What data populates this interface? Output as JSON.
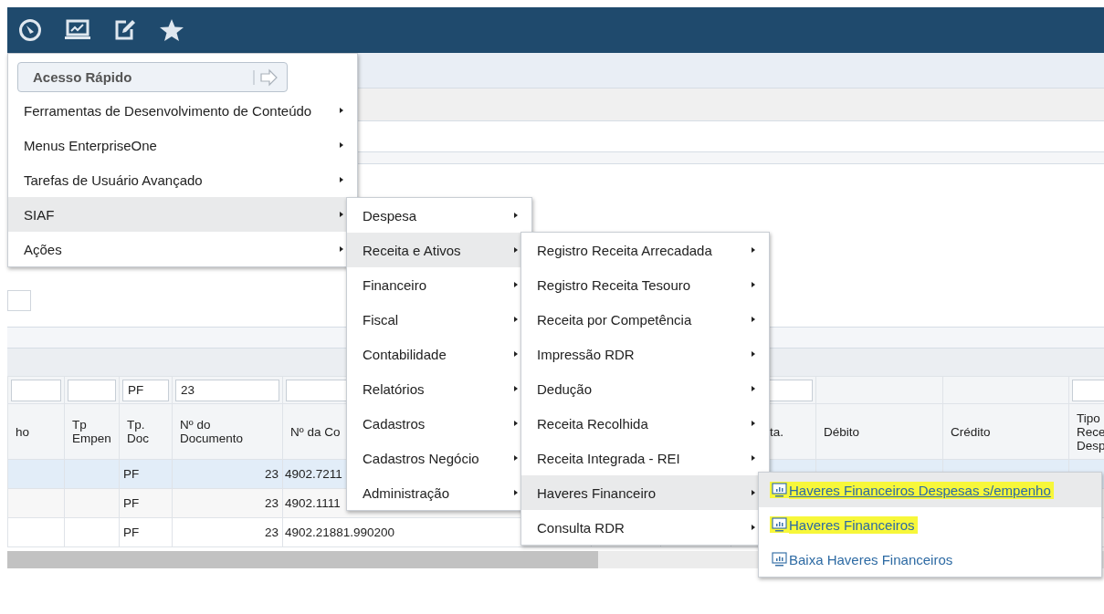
{
  "quick_access": {
    "placeholder": "Acesso Rápido"
  },
  "menu": {
    "items": [
      {
        "label": "Ferramentas de Desenvolvimento de Conteúdo",
        "selected": false
      },
      {
        "label": "Menus EnterpriseOne",
        "selected": false
      },
      {
        "label": "Tarefas de Usuário Avançado",
        "selected": false
      },
      {
        "label": "SIAF",
        "selected": true
      },
      {
        "label": "Ações",
        "selected": false
      }
    ]
  },
  "submenu_1": {
    "items": [
      {
        "label": "Despesa",
        "selected": false
      },
      {
        "label": "Receita e Ativos",
        "selected": true
      },
      {
        "label": "Financeiro",
        "selected": false
      },
      {
        "label": "Fiscal",
        "selected": false
      },
      {
        "label": "Contabilidade",
        "selected": false
      },
      {
        "label": "Relatórios",
        "selected": false
      },
      {
        "label": "Cadastros",
        "selected": false
      },
      {
        "label": "Cadastros Negócio",
        "selected": false
      },
      {
        "label": "Administração",
        "selected": false
      }
    ]
  },
  "submenu_2": {
    "items": [
      {
        "label": "Registro Receita Arrecadada",
        "selected": false
      },
      {
        "label": "Registro Receita Tesouro",
        "selected": false
      },
      {
        "label": "Receita por Competência",
        "selected": false
      },
      {
        "label": "Impressão RDR",
        "selected": false
      },
      {
        "label": "Dedução",
        "selected": false
      },
      {
        "label": "Receita Recolhida",
        "selected": false
      },
      {
        "label": "Receita Integrada - REI",
        "selected": false
      },
      {
        "label": "Haveres Financeiro",
        "selected": true
      },
      {
        "label": "Consulta RDR",
        "selected": false
      }
    ]
  },
  "submenu_3": {
    "items": [
      {
        "label": "Haveres Financeiros Despesas s/empenho",
        "selected": true,
        "highlighted": true
      },
      {
        "label": "Haveres Financeiros",
        "selected": false,
        "highlighted": true
      },
      {
        "label": "Baixa Haveres Financeiros",
        "selected": false,
        "highlighted": false
      }
    ]
  },
  "table": {
    "filters": [
      {
        "kind": "input"
      },
      {
        "kind": "input"
      },
      {
        "kind": "input",
        "value": "PF"
      },
      {
        "kind": "input",
        "value": "23"
      },
      {
        "kind": "input"
      },
      {
        "kind": "input"
      },
      {
        "kind": "none"
      },
      {
        "kind": "none"
      },
      {
        "kind": "input"
      }
    ],
    "columns": [
      {
        "label": "ho"
      },
      {
        "label": "Tp\nEmpen"
      },
      {
        "label": "Tp.\nDoc"
      },
      {
        "label": "Nº do\nDocumento"
      },
      {
        "label": "Nº da Co"
      },
      {
        "label": "ta."
      },
      {
        "label": "Débito"
      },
      {
        "label": "Crédito"
      },
      {
        "label": "Tipo\nRece\nDesp"
      }
    ],
    "rows": [
      {
        "selected": true,
        "cells": [
          null,
          null,
          "PF",
          "23",
          "4902.7211"
        ]
      },
      {
        "selected": false,
        "cells": [
          null,
          null,
          "PF",
          "23",
          "4902.1111"
        ]
      },
      {
        "selected": false,
        "cells": [
          null,
          null,
          "PF",
          "23",
          "4902.21881.990200"
        ]
      }
    ]
  }
}
